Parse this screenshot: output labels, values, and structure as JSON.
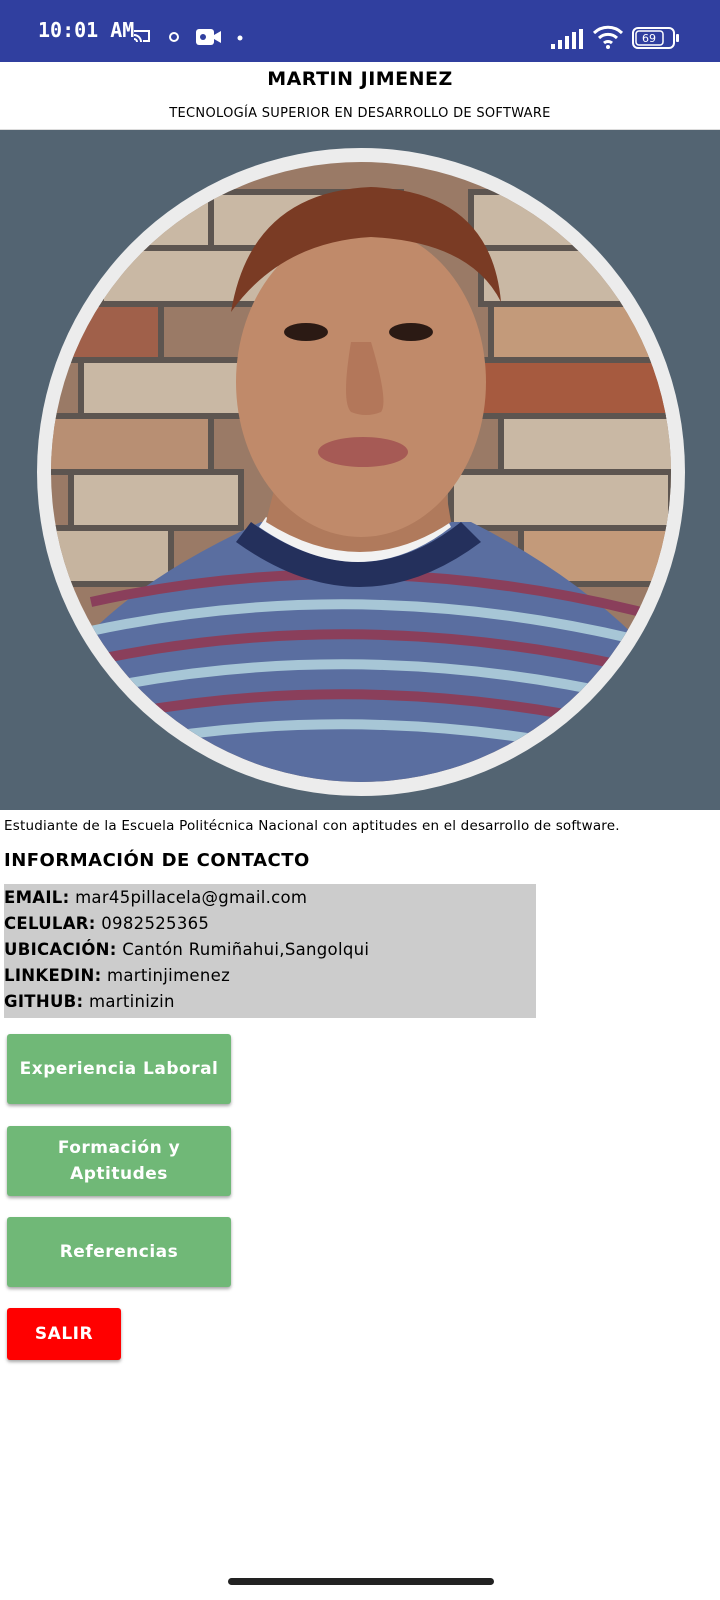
{
  "status_bar": {
    "time": "10:01 AM",
    "battery": "69",
    "icons": [
      "cast-icon",
      "notification-dot-icon",
      "video-camera-icon",
      "dot-icon",
      "signal-icon",
      "wifi-icon",
      "battery-icon"
    ]
  },
  "profile": {
    "name": "MARTIN JIMENEZ",
    "career": "TECNOLOGÍA SUPERIOR EN DESARROLLO DE SOFTWARE",
    "description": "Estudiante de la Escuela Politécnica Nacional con aptitudes en el desarrollo de software."
  },
  "contact": {
    "title": "INFORMACIÓN DE CONTACTO",
    "rows": [
      {
        "key": "EMAIL:",
        "value": "mar45pillacela@gmail.com"
      },
      {
        "key": "CELULAR:",
        "value": "0982525365"
      },
      {
        "key": "UBICACIÓN:",
        "value": "Cantón Rumiñahui,Sangolqui"
      },
      {
        "key": "LINKEDIN:",
        "value": "martinjimenez"
      },
      {
        "key": "GITHUB:",
        "value": "martinizin"
      }
    ]
  },
  "buttons": {
    "experience": "Experiencia Laboral",
    "formation_line1": "Formación y",
    "formation_line2": "Aptitudes",
    "references": "Referencias",
    "exit": "SALIR"
  },
  "colors": {
    "status_bar": "#303f9f",
    "photo_panel": "#536472",
    "contact_box": "#cccccc",
    "button_green": "#70b877",
    "button_red": "#ff0000"
  }
}
